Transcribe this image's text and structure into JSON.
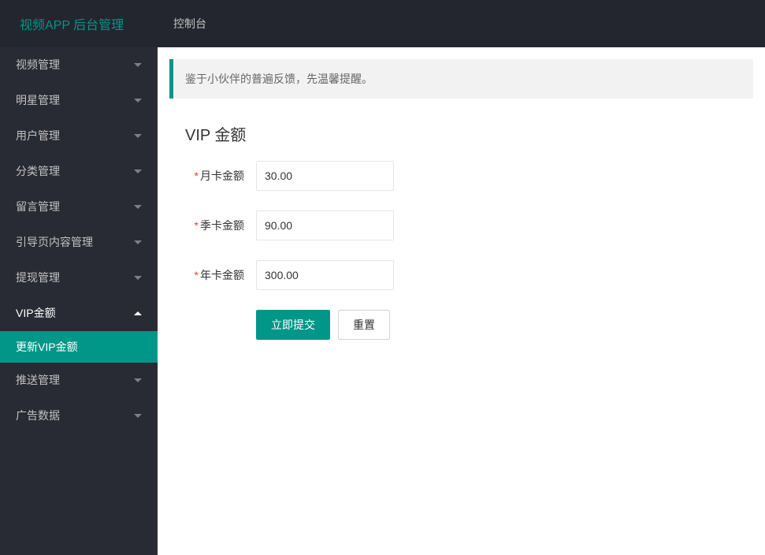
{
  "header": {
    "logo": "视频APP 后台管理",
    "nav": [
      {
        "label": "控制台"
      }
    ]
  },
  "sidebar": {
    "items": [
      {
        "label": "视频管理",
        "expanded": false
      },
      {
        "label": "明星管理",
        "expanded": false
      },
      {
        "label": "用户管理",
        "expanded": false
      },
      {
        "label": "分类管理",
        "expanded": false
      },
      {
        "label": "留言管理",
        "expanded": false
      },
      {
        "label": "引导页内容管理",
        "expanded": false
      },
      {
        "label": "提现管理",
        "expanded": false
      },
      {
        "label": "VIP金额",
        "expanded": true,
        "children": [
          {
            "label": "更新VIP金额",
            "active": true
          }
        ]
      },
      {
        "label": "推送管理",
        "expanded": false
      },
      {
        "label": "广告数据",
        "expanded": false
      }
    ]
  },
  "notice": "鉴于小伙伴的普遍反馈，先温馨提醒。",
  "form": {
    "legend": "VIP 金额",
    "fields": [
      {
        "label": "月卡金额",
        "value": "30.00",
        "required": true
      },
      {
        "label": "季卡金额",
        "value": "90.00",
        "required": true
      },
      {
        "label": "年卡金额",
        "value": "300.00",
        "required": true
      }
    ],
    "submit_label": "立即提交",
    "reset_label": "重置"
  }
}
